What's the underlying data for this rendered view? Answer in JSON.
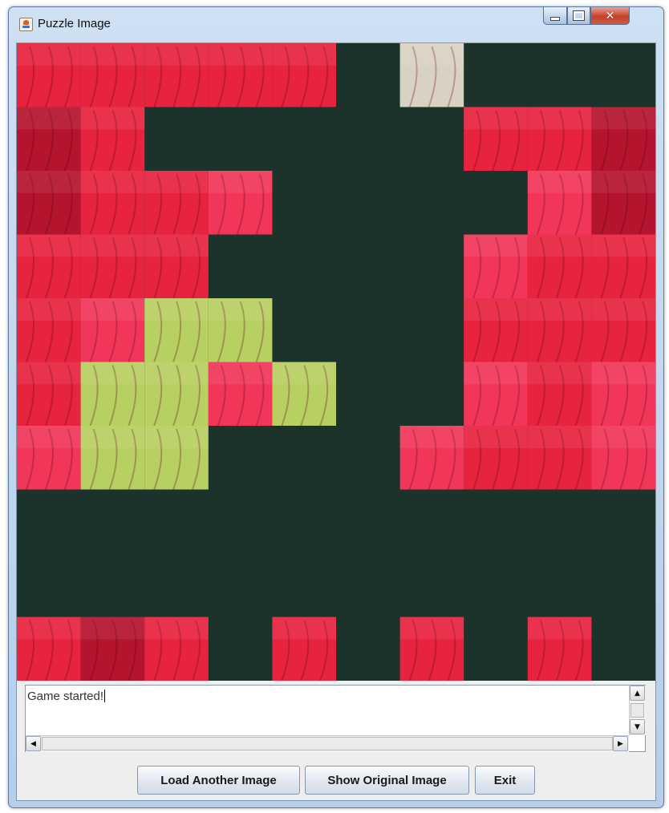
{
  "window": {
    "title": "Puzzle Image",
    "controls": {
      "minimize_icon": "minimize-icon",
      "maximize_icon": "maximize-icon",
      "close_icon": "close-icon",
      "close_glyph": "✕"
    }
  },
  "puzzle": {
    "rows": 10,
    "cols": 10,
    "background_color": "#1c332b",
    "tile_colors": {
      "r": "#e8233f",
      "d": "#b5142e",
      "p": "#f2365a",
      "g": "#b8cf62",
      "w": "#d8d2c3"
    },
    "grid": [
      "rrrrr.w...",
      "dr.....rrd",
      "drrp....pd",
      "rrr....prr",
      "rpgg...rrr",
      "rggpg..prp",
      "pgg...prrp",
      "..........",
      "..........",
      "rdr.r.r.r."
    ]
  },
  "log": {
    "text": "Game started!",
    "scroll_up_glyph": "▲",
    "scroll_down_glyph": "▼",
    "scroll_left_glyph": "◀",
    "scroll_right_glyph": "▶"
  },
  "buttons": {
    "load": "Load Another Image",
    "show": "Show Original Image",
    "exit": "Exit"
  }
}
